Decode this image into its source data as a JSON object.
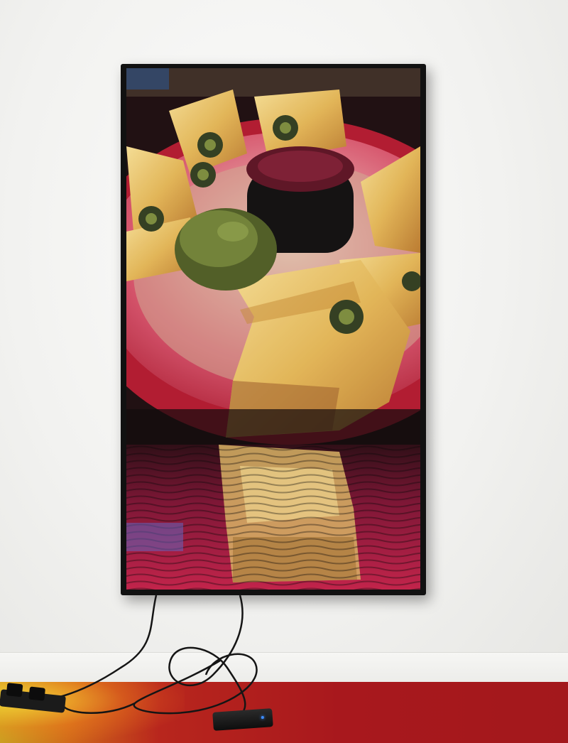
{
  "scene": {
    "subject": "",
    "colors": {
      "wall": "#f3f3f1",
      "floor": "#a8181d",
      "plate": "#c21f2c",
      "cheese": "#e8c36a",
      "jalapeno": "#2f3a1c",
      "salsa": "#5a1020",
      "guacamole": "#5c6a2a"
    },
    "icons": [
      "television",
      "power-strip",
      "media-player",
      "cable"
    ]
  }
}
